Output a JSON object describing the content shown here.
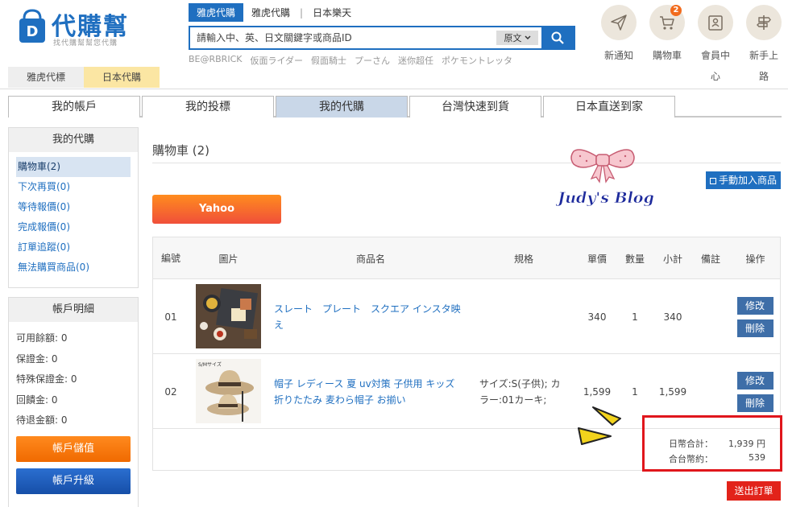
{
  "header": {
    "logo_title": "代購幫",
    "logo_subtitle": "找代購幫幫您代購",
    "search_tabs": [
      "雅虎代購",
      "雅虎代購",
      "日本樂天"
    ],
    "search_placeholder": "請輸入中、英、日文關鍵字或商品ID",
    "lang_select": "原文",
    "hot_tags": [
      "BE@RBRICK",
      "仮面ライダー",
      "假面騎士",
      "プーさん",
      "迷你超任",
      "ポケモントレッタ"
    ],
    "icons": [
      {
        "icon": "paper-plane-icon",
        "label": "新通知"
      },
      {
        "icon": "cart-icon",
        "label": "購物車",
        "badge": "2"
      },
      {
        "icon": "member-card-icon",
        "label": "會員中心"
      },
      {
        "icon": "signpost-icon",
        "label": "新手上路"
      }
    ],
    "site_tabs": [
      "雅虎代標",
      "日本代購"
    ]
  },
  "main_nav": [
    "我的帳戶",
    "我的投標",
    "我的代購",
    "台灣快速到貨",
    "日本直送到家"
  ],
  "sidebar": {
    "section1_title": "我的代購",
    "items": [
      "購物車(2)",
      "下次再買(0)",
      "等待報價(0)",
      "完成報價(0)",
      "訂單追蹤(0)",
      "無法購買商品(0)"
    ],
    "section2_title": "帳戶明細",
    "account": [
      "可用餘額: 0",
      "保證金: 0",
      "特殊保證金: 0",
      "回饋金: 0",
      "待退金額: 0"
    ],
    "btn_deposit": "帳戶儲值",
    "btn_upgrade": "帳戶升級"
  },
  "content": {
    "title": "購物車 (2)",
    "manual_add": "手動加入商品",
    "blog_watermark": "Judy's Blog",
    "store_tab": "Yahoo",
    "columns": [
      "編號",
      "圖片",
      "商品名",
      "規格",
      "單價",
      "數量",
      "小計",
      "備註",
      "操作"
    ],
    "rows": [
      {
        "no": "01",
        "name": "スレート　プレート　スクエア インスタ映え",
        "spec": "",
        "price": "340",
        "qty": "1",
        "subtotal": "340",
        "note": "",
        "edit": "修改",
        "delete": "刪除"
      },
      {
        "no": "02",
        "name": "帽子 レディース 夏 uv対策 子供用 キッズ 折りたたみ 麦わら帽子 お揃い",
        "spec": "サイズ:S(子供); カラー:01カーキ;",
        "price": "1,599",
        "qty": "1",
        "subtotal": "1,599",
        "note": "",
        "edit": "修改",
        "delete": "刪除",
        "thumb_text": "S/Mサイズ"
      }
    ],
    "totals": {
      "jpy_label": "日幣合計：",
      "jpy_value": "1,939 円",
      "twd_label": "合台幣約：",
      "twd_value": "539"
    },
    "submit": "送出訂單"
  },
  "colors": {
    "brand_blue": "#1f6fc0",
    "orange": "#f26b1d",
    "red": "#e0161c"
  }
}
